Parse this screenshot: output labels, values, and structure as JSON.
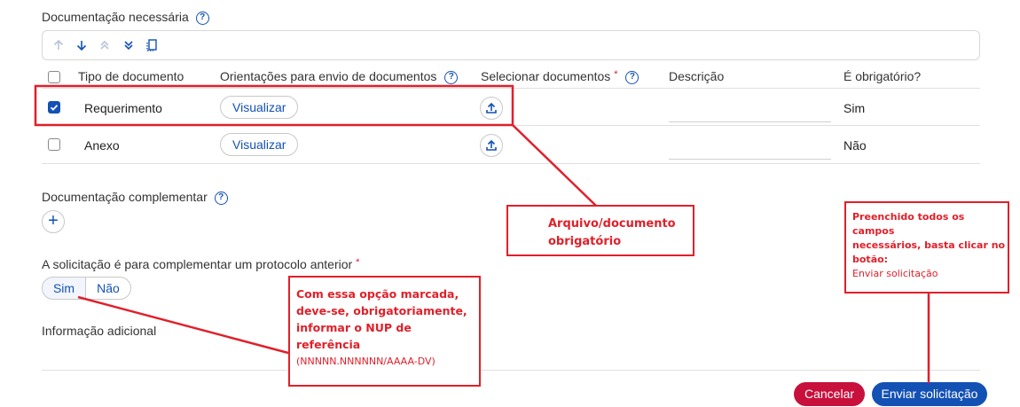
{
  "doc_section": {
    "title": "Documentação necessária",
    "help_glyph": "?",
    "toolbar_icons": [
      "arrow-up-icon",
      "arrow-down-icon",
      "double-chevron-up-icon",
      "double-chevron-down-icon",
      "copy-icon"
    ]
  },
  "table": {
    "headers": {
      "tipo": "Tipo de documento",
      "orientacoes": "Orientações para envio de documentos",
      "selecionar": "Selecionar documentos",
      "required_mark": "*",
      "descricao": "Descrição",
      "obrigatorio": "É obrigatório?"
    },
    "rows": [
      {
        "checked": true,
        "tipo": "Requerimento",
        "action": "Visualizar",
        "obrigatorio": "Sim"
      },
      {
        "checked": false,
        "tipo": "Anexo",
        "action": "Visualizar",
        "obrigatorio": "Não"
      }
    ]
  },
  "complement": {
    "title": "Documentação complementar",
    "add_glyph": "+"
  },
  "protocol": {
    "question": "A solicitação é para complementar um protocolo anterior",
    "required_mark": "*",
    "options": [
      "Sim",
      "Não"
    ]
  },
  "info": {
    "label": "Informação adicional"
  },
  "annotations": {
    "arquivo": {
      "line1": "Arquivo/documento",
      "line2": "obrigatório"
    },
    "preenchido": {
      "line1": "Preenchido todos os campos",
      "line2": "necessários, basta clicar no",
      "line3": "botão:",
      "line4": "Enviar solicitação"
    },
    "opcao": {
      "line1": "Com essa opção marcada,",
      "line2": "deve-se, obrigatoriamente,",
      "line3": "informar o NUP de referência",
      "line4": "(NNNNN.NNNNNN/AAAA-DV)"
    },
    "color": "#e0202a"
  },
  "footer": {
    "cancel": "Cancelar",
    "send": "Enviar solicitação"
  },
  "colors": {
    "primary": "#1351b4",
    "danger": "#c8103c"
  }
}
